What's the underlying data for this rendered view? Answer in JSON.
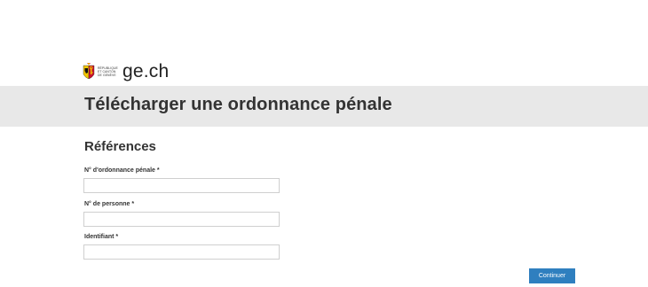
{
  "header": {
    "crest_lines": [
      "RÉPUBLIQUE",
      "ET CANTON",
      "DE GENÈVE"
    ],
    "site_name": "ge.ch",
    "logo_icon": "geneva-coat-of-arms-icon"
  },
  "page": {
    "title": "Télécharger une ordonnance pénale"
  },
  "form": {
    "section_title": "Références",
    "fields": [
      {
        "label": "N° d'ordonnance pénale *",
        "value": "",
        "placeholder": ""
      },
      {
        "label": "N° de personne *",
        "value": "",
        "placeholder": ""
      },
      {
        "label": "Identifiant *",
        "value": "",
        "placeholder": ""
      }
    ],
    "submit_label": "Continuer"
  },
  "colors": {
    "title_band": "#e8e8e8",
    "button": "#2f7fbf",
    "crest_red": "#c8102e",
    "crest_yellow": "#f2c500"
  }
}
